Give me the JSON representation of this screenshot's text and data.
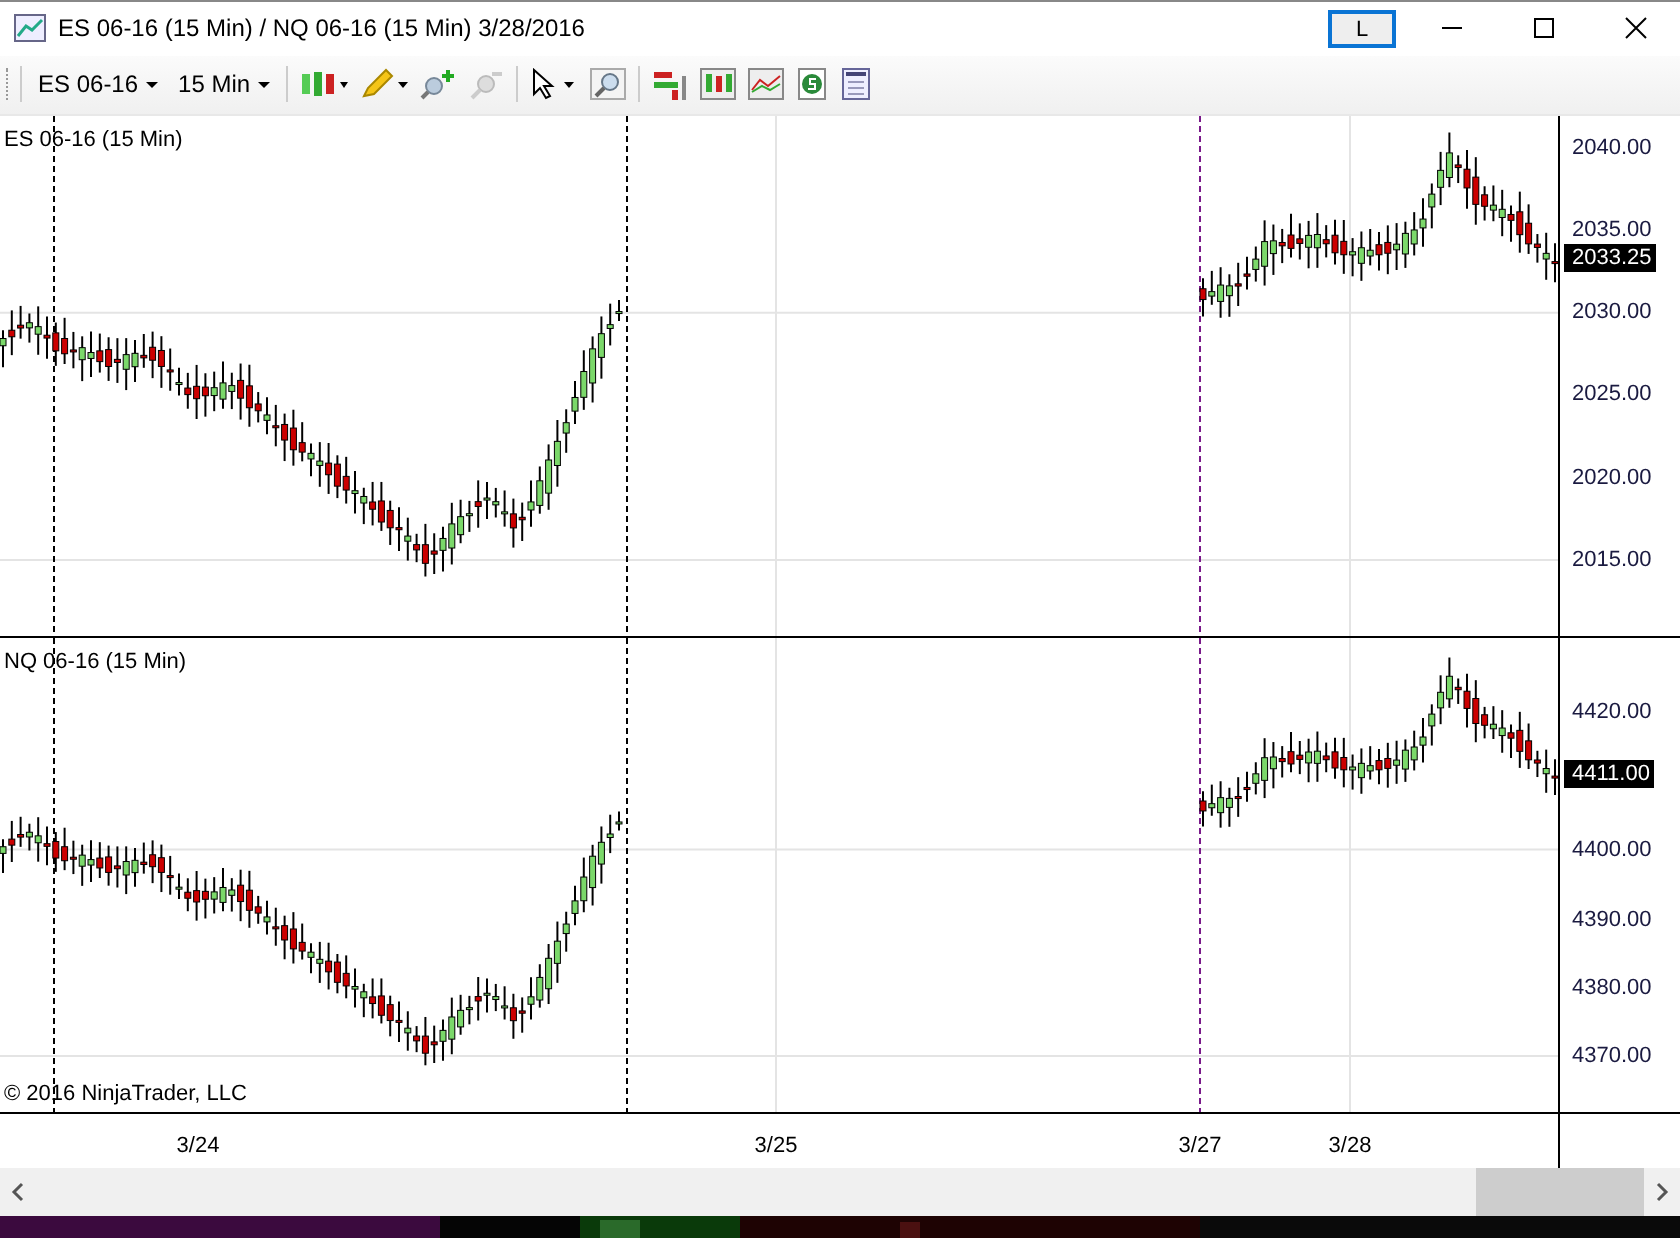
{
  "window": {
    "title": "ES 06-16 (15 Min) / NQ 06-16 (15 Min)  3/28/2016",
    "link_button": "L"
  },
  "toolbar": {
    "instrument": "ES 06-16",
    "interval": "15 Min"
  },
  "panels": [
    {
      "label": "ES 06-16 (15 Min)",
      "yticks": [
        "2040.00",
        "2035.00",
        "2030.00",
        "2025.00",
        "2020.00",
        "2015.00"
      ],
      "last_price": "2033.25"
    },
    {
      "label": "NQ 06-16 (15 Min)",
      "yticks": [
        "4420.00",
        "4400.00",
        "4390.00",
        "4380.00",
        "4370.00"
      ],
      "last_price": "4411.00"
    }
  ],
  "copyright": "© 2016 NinjaTrader, LLC",
  "x_labels": [
    "3/24",
    "3/25",
    "3/27",
    "3/28"
  ]
}
